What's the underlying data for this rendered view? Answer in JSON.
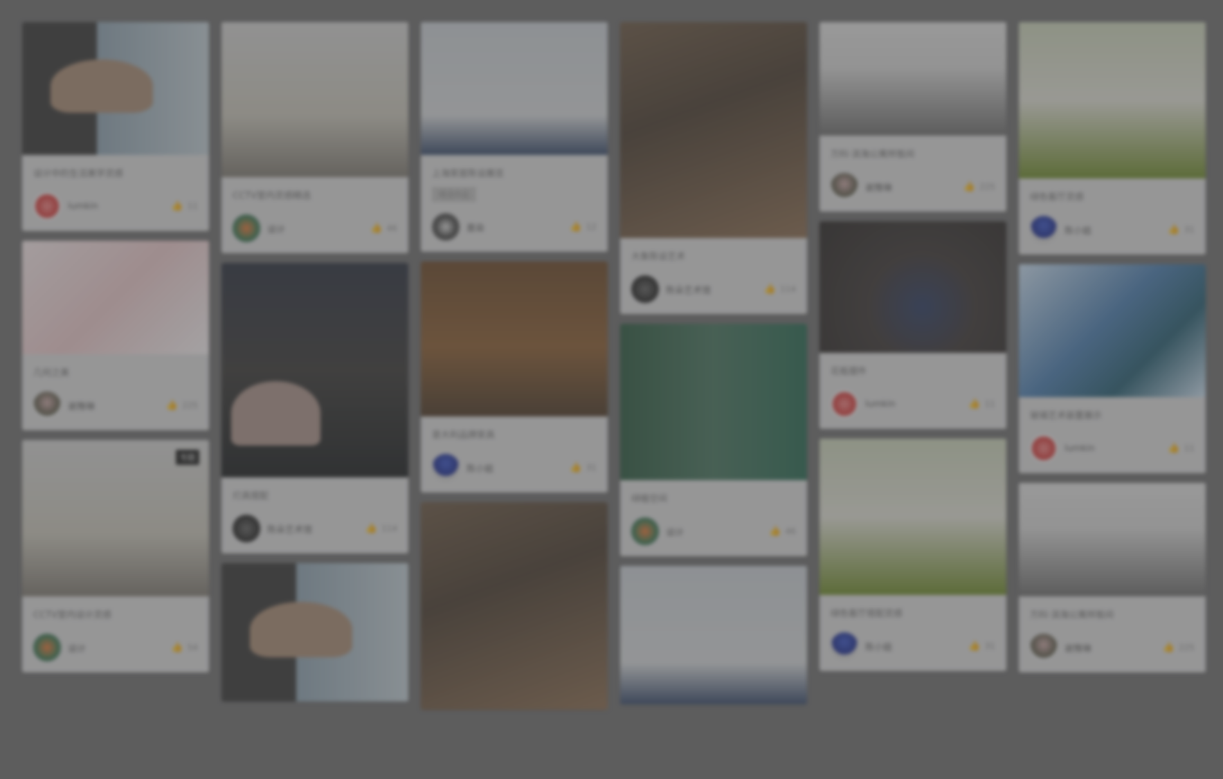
{
  "columns": [
    {
      "cards": [
        {
          "img": "img-chair",
          "h": 192,
          "title": "设计中的生活美学灵感",
          "author": "lumkin",
          "likes": "11",
          "avatar": "av-red"
        },
        {
          "img": "img-pink",
          "h": 164,
          "title": "几何之美",
          "author": "谢豫琳",
          "likes": "225",
          "avatar": "av-man"
        },
        {
          "img": "img-room",
          "h": 226,
          "badge": "专题",
          "title": "CCTV室内设计灵感",
          "author": "设计",
          "likes": "54",
          "avatar": "av-color"
        }
      ]
    },
    {
      "cards": [
        {
          "img": "img-room",
          "h": 224,
          "title": "CCTV室内灵感精选",
          "author": "设计",
          "likes": "46",
          "avatar": "av-color"
        },
        {
          "img": "img-lamp",
          "h": 310,
          "title": "灯具搭配",
          "author": "陈朵艺术馆",
          "likes": "114",
          "avatar": "av-dark"
        },
        {
          "img": "img-chair",
          "h": 200,
          "title": "",
          "author": "",
          "likes": "",
          "avatar": "av-red"
        }
      ]
    },
    {
      "cards": [
        {
          "img": "img-shelf",
          "h": 192,
          "title": "上海家居陈设展览",
          "tag": "精选作品",
          "author": "墨染",
          "likes": "12",
          "avatar": "av-ink"
        },
        {
          "img": "img-sofa",
          "h": 224,
          "title": "意大利品牌家具",
          "author": "陈小姐",
          "likes": "31",
          "avatar": "av-blue"
        },
        {
          "img": "img-cat",
          "h": 300,
          "title": "",
          "author": "",
          "likes": "",
          "avatar": "av-dark"
        }
      ]
    },
    {
      "cards": [
        {
          "img": "img-cat",
          "h": 312,
          "title": "大象陈设艺术",
          "author": "陈朵艺术馆",
          "likes": "114",
          "avatar": "av-dark"
        },
        {
          "img": "img-plant",
          "h": 226,
          "title": "绿植空间",
          "author": "设计",
          "likes": "46",
          "avatar": "av-color"
        },
        {
          "img": "img-shelf",
          "h": 200,
          "title": "",
          "author": "",
          "likes": "",
          "avatar": "av-ink"
        }
      ]
    },
    {
      "cards": [
        {
          "img": "img-office",
          "h": 164,
          "title": "万科·滨海公寓样板间",
          "author": "谢豫琳",
          "likes": "225",
          "avatar": "av-man"
        },
        {
          "img": "img-vase",
          "h": 190,
          "title": "花瓶摆件",
          "author": "lumkin",
          "likes": "11",
          "avatar": "av-red"
        },
        {
          "img": "img-green",
          "h": 226,
          "title": "绿色客厅搭配灵感",
          "author": "陈小姐",
          "likes": "31",
          "avatar": "av-blue"
        }
      ]
    },
    {
      "cards": [
        {
          "img": "img-green",
          "h": 226,
          "title": "绿色客厅灵感",
          "author": "陈小姐",
          "likes": "31",
          "avatar": "av-blue"
        },
        {
          "img": "img-glass",
          "h": 192,
          "title": "玻璃艺术装置展示",
          "author": "lumkin",
          "likes": "11",
          "avatar": "av-red"
        },
        {
          "img": "img-office",
          "h": 164,
          "title": "万科·滨海公寓样板间",
          "author": "谢豫琳",
          "likes": "225",
          "avatar": "av-man"
        }
      ]
    }
  ]
}
